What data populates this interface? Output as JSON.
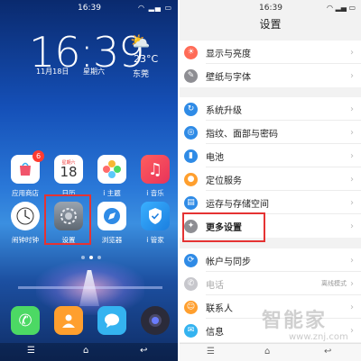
{
  "home": {
    "status_time": "16:39",
    "clock": "16:39",
    "temperature": "23°C",
    "city": "东莞",
    "date": "11月18日",
    "weekday": "星期六",
    "apps": [
      {
        "label": "应用商店",
        "badge": "6"
      },
      {
        "label": "日历",
        "cal_day": "18",
        "cal_week": "星期六"
      },
      {
        "label": "i 主题"
      },
      {
        "label": "i 音乐"
      },
      {
        "label": "闹钟时钟"
      },
      {
        "label": "设置"
      },
      {
        "label": "浏览器"
      },
      {
        "label": "i 管家"
      }
    ]
  },
  "settings": {
    "status_time": "16:39",
    "title": "设置",
    "items": [
      {
        "label": "显示与亮度"
      },
      {
        "label": "壁纸与字体"
      },
      {
        "label": "系统升级"
      },
      {
        "label": "指纹、面部与密码"
      },
      {
        "label": "电池"
      },
      {
        "label": "定位服务"
      },
      {
        "label": "运存与存储空间"
      },
      {
        "label": "更多设置"
      },
      {
        "label": "帐户与同步"
      },
      {
        "label": "电话",
        "value": "离线模式"
      },
      {
        "label": "联系人"
      },
      {
        "label": "信息"
      }
    ]
  },
  "watermark": {
    "brand": "智能家",
    "url": "www.znj.com"
  },
  "colors": {
    "highlight": "#e53333",
    "accent": "#2f8be6"
  }
}
